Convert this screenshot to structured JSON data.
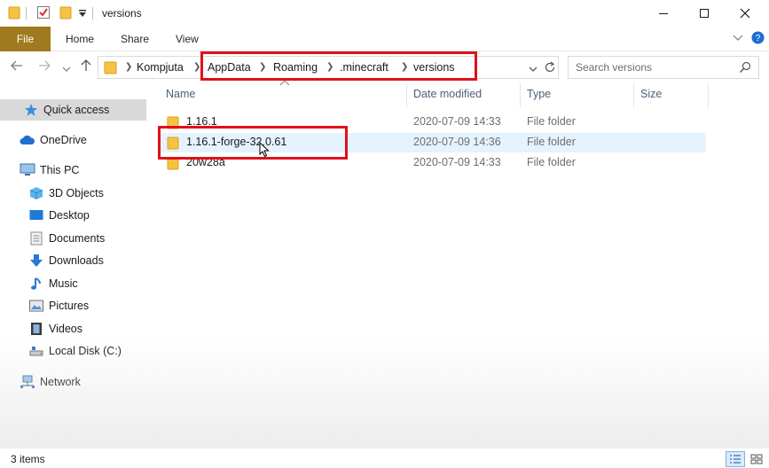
{
  "window": {
    "title": "versions"
  },
  "ribbon": {
    "tabs": [
      {
        "label": "File"
      },
      {
        "label": "Home"
      },
      {
        "label": "Share"
      },
      {
        "label": "View"
      }
    ]
  },
  "address": {
    "crumbs": [
      "Kompjuta",
      "AppData",
      "Roaming",
      ".minecraft",
      "versions"
    ]
  },
  "search": {
    "placeholder": "Search versions"
  },
  "sidebar": {
    "items": [
      {
        "label": "Quick access",
        "icon": "star-icon"
      },
      {
        "label": "OneDrive",
        "icon": "cloud-icon"
      },
      {
        "label": "This PC",
        "icon": "computer-icon"
      },
      {
        "label": "3D Objects",
        "icon": "cube-icon"
      },
      {
        "label": "Desktop",
        "icon": "desktop-icon"
      },
      {
        "label": "Documents",
        "icon": "document-icon"
      },
      {
        "label": "Downloads",
        "icon": "download-icon"
      },
      {
        "label": "Music",
        "icon": "music-icon"
      },
      {
        "label": "Pictures",
        "icon": "picture-icon"
      },
      {
        "label": "Videos",
        "icon": "video-icon"
      },
      {
        "label": "Local Disk (C:)",
        "icon": "disk-icon"
      },
      {
        "label": "Network",
        "icon": "network-icon"
      }
    ]
  },
  "columns": {
    "name": "Name",
    "date": "Date modified",
    "type": "Type",
    "size": "Size"
  },
  "files": [
    {
      "name": "1.16.1",
      "date": "2020-07-09 14:33",
      "type": "File folder"
    },
    {
      "name": "1.16.1-forge-32.0.61",
      "date": "2020-07-09 14:36",
      "type": "File folder"
    },
    {
      "name": "20w28a",
      "date": "2020-07-09 14:33",
      "type": "File folder"
    }
  ],
  "status": {
    "items_count": "3 items"
  },
  "colors": {
    "file_tab": "#a07a1e",
    "folder": "#f5c242",
    "highlight": "#e0101a",
    "selection": "#e5f3ff"
  }
}
